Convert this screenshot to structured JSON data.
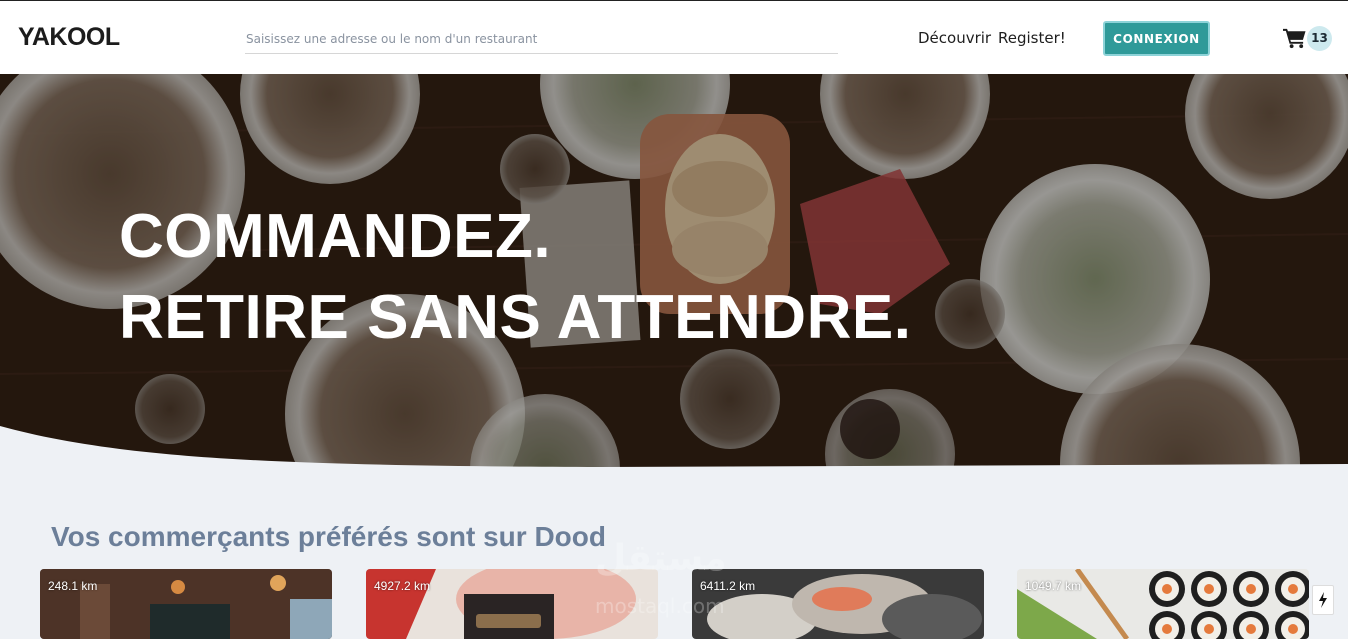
{
  "header": {
    "logo": "YAKOOL",
    "search_placeholder": "Saisissez une adresse ou le nom d'un restaurant",
    "nav": {
      "discover": "Découvrir",
      "register": "Register!"
    },
    "login_label": "CONNEXION",
    "cart_count": "13"
  },
  "hero": {
    "line1": "COMMANDEZ.",
    "line2": "RETIRE SANS ATTENDRE."
  },
  "section": {
    "title": "Vos commerçants préférés sont sur Dood"
  },
  "cards": [
    {
      "distance": "248.1 km"
    },
    {
      "distance": "4927.2 km"
    },
    {
      "distance": "6411.2 km"
    },
    {
      "distance": "1049.7 km"
    }
  ],
  "watermark": {
    "arabic": "مستقل",
    "latin": "mostaql.com"
  },
  "colors": {
    "accent": "#2f9a99",
    "section_title": "#6c7f99",
    "page_bg": "#eef1f5"
  },
  "icons": {
    "cart": "shopping-cart-icon",
    "side": "lightning-icon"
  }
}
